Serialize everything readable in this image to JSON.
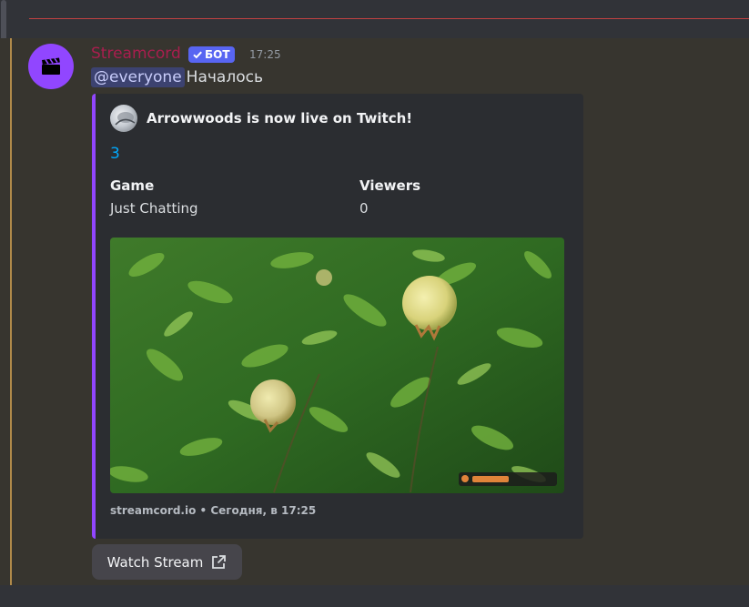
{
  "message": {
    "username": "Streamcord",
    "bot_badge": "БОТ",
    "timestamp": "17:25",
    "mention": "@everyone",
    "content": "Началось",
    "colors": {
      "username": "#a91e4e",
      "mention_bg": "#3c4270",
      "embed_accent": "#9146ff",
      "avatar_bg": "#9146ff",
      "link": "#00a8fc"
    }
  },
  "embed": {
    "author": "Arrowwoods is now live on Twitch!",
    "title": "3",
    "fields": [
      {
        "name": "Game",
        "value": "Just Chatting"
      },
      {
        "name": "Viewers",
        "value": "0"
      }
    ],
    "image": "stream-thumbnail",
    "footer": "streamcord.io • Сегодня, в 17:25"
  },
  "button": {
    "label": "Watch Stream",
    "icon": "external-link-icon"
  },
  "icons": {
    "avatar": "clapperboard-icon",
    "badge": "checkmark-icon"
  }
}
